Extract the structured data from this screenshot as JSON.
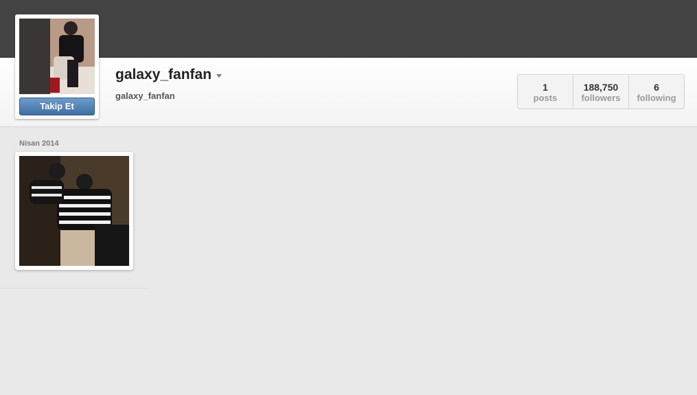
{
  "profile": {
    "username": "galaxy_fanfan",
    "full_name": "galaxy_fanfan",
    "follow_label": "Takip Et"
  },
  "stats": [
    {
      "value": "1",
      "label": "posts"
    },
    {
      "value": "188,750",
      "label": "followers"
    },
    {
      "value": "6",
      "label": "following"
    }
  ],
  "feed": {
    "date_label": "Nisan 2014"
  },
  "colors": {
    "topbar": "#434343",
    "follow_button": "#4f7fb3",
    "background": "#e9e9e9"
  }
}
